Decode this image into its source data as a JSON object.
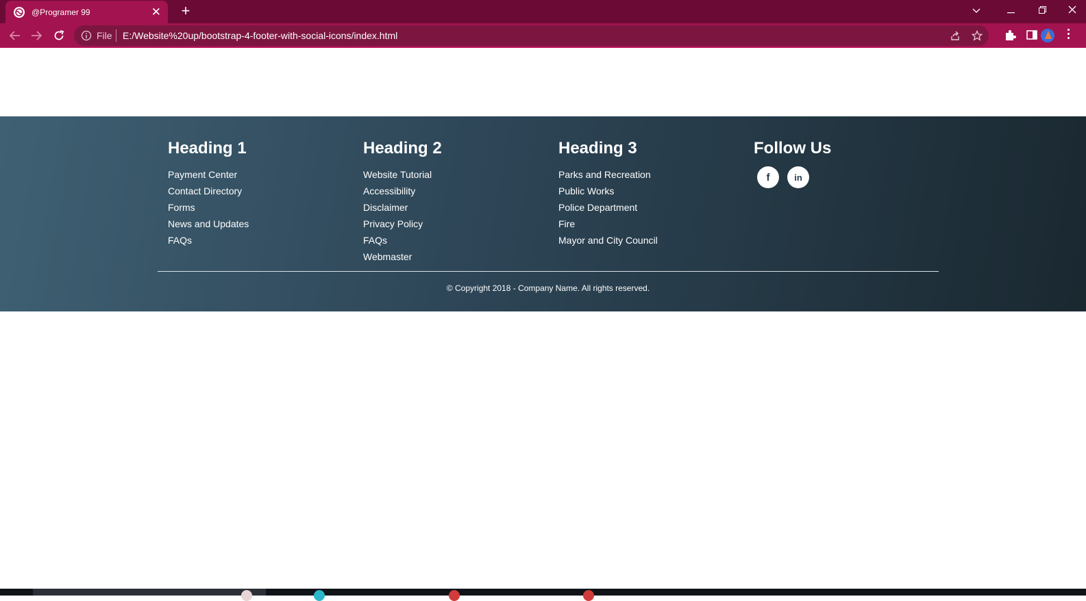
{
  "browser": {
    "tab": {
      "title": "@Programer 99",
      "close": "✕"
    },
    "new_tab": "+",
    "window_controls": {
      "dropdown": "⌵",
      "minimize": "—",
      "restore": "⧉",
      "close": "✕"
    },
    "address": {
      "scheme_label": "File",
      "url": "E:/Website%20up/bootstrap-4-footer-with-social-icons/index.html"
    }
  },
  "footer": {
    "columns": [
      {
        "heading": "Heading 1",
        "links": [
          "Payment Center",
          "Contact Directory",
          "Forms",
          "News and Updates",
          "FAQs"
        ]
      },
      {
        "heading": "Heading 2",
        "links": [
          "Website Tutorial",
          "Accessibility",
          "Disclaimer",
          "Privacy Policy",
          "FAQs",
          "Webmaster"
        ]
      },
      {
        "heading": "Heading 3",
        "links": [
          "Parks and Recreation",
          "Public Works",
          "Police Department",
          "Fire",
          "Mayor and City Council"
        ]
      }
    ],
    "follow": {
      "heading": "Follow Us",
      "icons": [
        {
          "name": "facebook-icon",
          "glyph": "f"
        },
        {
          "name": "linkedin-icon",
          "glyph": "in"
        }
      ]
    },
    "copyright": "© Copyright 2018 - Company Name. All rights reserved."
  },
  "colors": {
    "tabbar": "#6a0a35",
    "toolbar": "#a3134f",
    "footer_gradient_start": "#3f6073",
    "footer_gradient_end": "#1a2830"
  }
}
